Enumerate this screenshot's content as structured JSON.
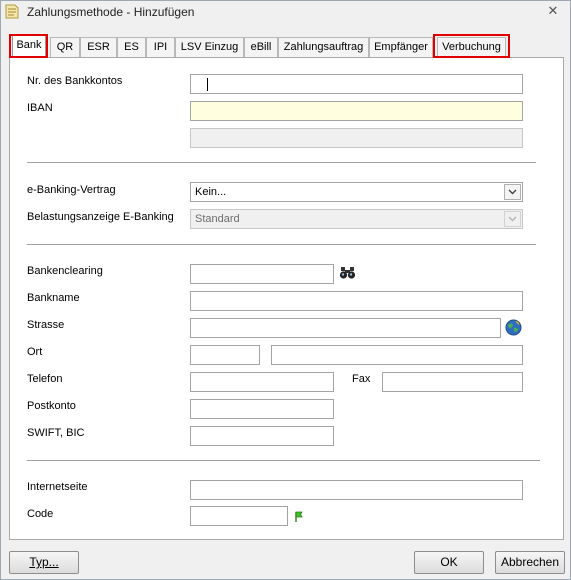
{
  "window": {
    "title": "Zahlungsmethode - Hinzufügen",
    "close_glyph": "✕"
  },
  "tabs": [
    {
      "label": "Bank",
      "active": true,
      "highlighted": true
    },
    {
      "label": "QR"
    },
    {
      "label": "ESR"
    },
    {
      "label": "ES"
    },
    {
      "label": "IPI"
    },
    {
      "label": "LSV Einzug"
    },
    {
      "label": "eBill"
    },
    {
      "label": "Zahlungsauftrag"
    },
    {
      "label": "Empfänger"
    },
    {
      "label": "Verbuchung",
      "highlighted": true
    }
  ],
  "form": {
    "account_number": {
      "label": "Nr. des Bankkontos",
      "value": ""
    },
    "iban": {
      "label": "IBAN",
      "value": ""
    },
    "iban_extra": {
      "value": ""
    },
    "ebanking_contract": {
      "label": "e-Banking-Vertrag",
      "value": "Kein...",
      "options": [
        "Kein..."
      ]
    },
    "debit_notice": {
      "label": "Belastungsanzeige E-Banking",
      "value": "Standard"
    },
    "bank_clearing": {
      "label": "Bankenclearing",
      "value": ""
    },
    "bank_name": {
      "label": "Bankname",
      "value": ""
    },
    "street": {
      "label": "Strasse",
      "value": ""
    },
    "city": {
      "label": "Ort",
      "zip_value": "",
      "city_value": ""
    },
    "phone": {
      "label": "Telefon",
      "value": ""
    },
    "fax": {
      "label": "Fax",
      "value": ""
    },
    "postal_account": {
      "label": "Postkonto",
      "value": ""
    },
    "swift_bic": {
      "label": "SWIFT, BIC",
      "value": ""
    },
    "website": {
      "label": "Internetseite",
      "value": ""
    },
    "code": {
      "label": "Code",
      "value": ""
    }
  },
  "icons": {
    "search": "binoculars-icon",
    "globe": "globe-icon",
    "code_flag": "flag-icon"
  },
  "colors": {
    "highlight": "#e00000",
    "iban_bg": "#ffffe0"
  },
  "footer": {
    "type_button": "Typ...",
    "ok_button": "OK",
    "cancel_button": "Abbrechen"
  }
}
